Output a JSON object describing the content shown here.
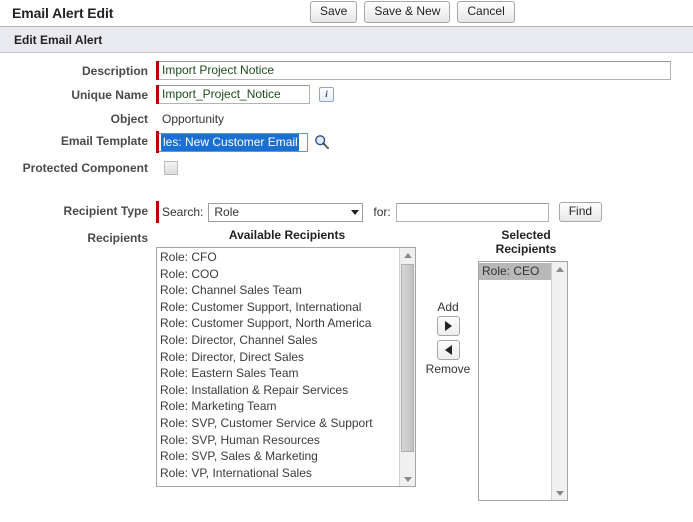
{
  "header": {
    "title": "Email Alert Edit",
    "buttons": [
      {
        "label": "Save",
        "name": "save-button"
      },
      {
        "label": "Save & New",
        "name": "save-and-new-button"
      },
      {
        "label": "Cancel",
        "name": "cancel-button"
      }
    ]
  },
  "section": {
    "title": "Edit Email Alert"
  },
  "fields": {
    "description": {
      "label": "Description",
      "value": "Import Project Notice",
      "placeholder": "",
      "required": true
    },
    "unique_name": {
      "label": "Unique Name",
      "value": "Import_Project_Notice",
      "placeholder": "",
      "required": true,
      "info_icon": "info-icon"
    },
    "object": {
      "label": "Object",
      "value": "Opportunity"
    },
    "email_template": {
      "label": "Email Template",
      "selected_text": "les: New Customer Email",
      "required": true,
      "lookup_icon": "magnifier-icon"
    },
    "protected_component": {
      "label": "Protected Component",
      "checked": false,
      "disabled": true
    },
    "recipient_type": {
      "label": "Recipient Type",
      "search_label": "Search:",
      "search_value": "Role",
      "for_label": "for:",
      "for_value": "",
      "for_placeholder": "",
      "find_label": "Find",
      "required": true
    },
    "recipients": {
      "label": "Recipients",
      "available_caption": "Available Recipients",
      "selected_caption": "Selected Recipients",
      "add_label": "Add",
      "remove_label": "Remove",
      "available": [
        "Role: CFO",
        "Role: COO",
        "Role: Channel Sales Team",
        "Role: Customer Support, International",
        "Role: Customer Support, North America",
        "Role: Director, Channel Sales",
        "Role: Director, Direct Sales",
        "Role: Eastern Sales Team",
        "Role: Installation & Repair Services",
        "Role: Marketing Team",
        "Role: SVP, Customer Service & Support",
        "Role: SVP, Human Resources",
        "Role: SVP, Sales & Marketing",
        "Role: VP, International Sales"
      ],
      "selected": [
        "Role: CEO"
      ]
    }
  },
  "colors": {
    "required_bar": "#c00000",
    "section_header_bg": "#e9e9f0",
    "text_selection_bg": "#1a6fd4",
    "list_selected_bg": "#b8b8b8",
    "input_text": "#1d4d1d"
  }
}
